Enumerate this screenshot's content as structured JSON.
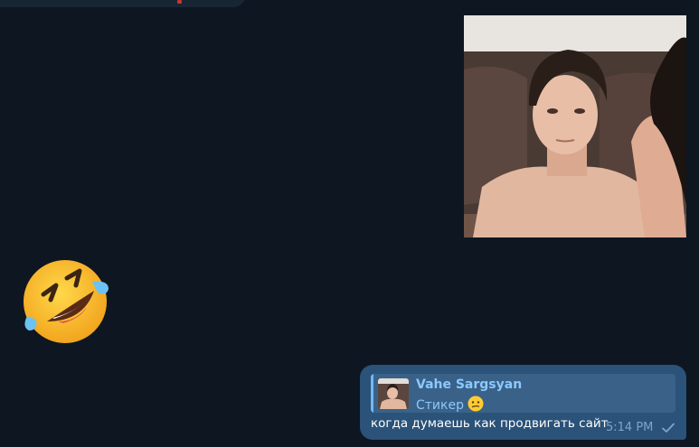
{
  "chat": {
    "message": {
      "reply_author": "Vahe Sargsyan",
      "reply_preview": "Стикер",
      "text": "когда думаешь как продвигать сайт",
      "time": "5:14 PM",
      "status_icon": "single-check-icon"
    },
    "emoji_sticker": {
      "icon": "rolling-on-floor-laughing-icon"
    },
    "photo_sticker": {
      "icon": "photo-sticker"
    }
  },
  "colors": {
    "background": "#0e1621",
    "outgoing_bubble": "#2b5278",
    "incoming_bubble": "#182533",
    "reply_accent": "#73b9f5",
    "time_color": "#7da6cc"
  }
}
